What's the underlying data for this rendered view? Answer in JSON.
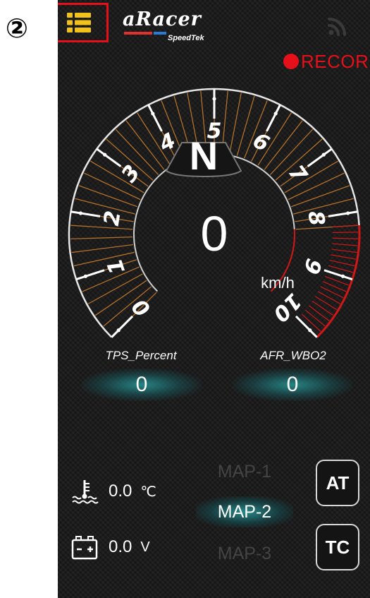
{
  "annotation": {
    "step_label": "②"
  },
  "header": {
    "logo_text": "aRacer",
    "logo_subtext": "SpeedTek",
    "menu_icon": "list-menu-icon",
    "signal_icon": "rss-signal-icon",
    "record_label": "RECOR"
  },
  "gauge": {
    "gear": "N",
    "speed": "0",
    "speed_unit": "km/h",
    "rpm_ticks": [
      "0",
      "1",
      "2",
      "3",
      "4",
      "5",
      "6",
      "7",
      "8",
      "9",
      "10"
    ],
    "redline_from": 8.2
  },
  "sensors": [
    {
      "label": "TPS_Percent",
      "value": "0"
    },
    {
      "label": "AFR_WBO2",
      "value": "0"
    }
  ],
  "stats": {
    "temperature": {
      "value": "0.0",
      "unit": "℃",
      "icon": "coolant-temperature-icon"
    },
    "voltage": {
      "value": "0.0",
      "unit": "V",
      "icon": "battery-icon"
    }
  },
  "maps": [
    {
      "label": "MAP-1",
      "active": false
    },
    {
      "label": "MAP-2",
      "active": true
    },
    {
      "label": "MAP-3",
      "active": false
    }
  ],
  "buttons": {
    "at": "AT",
    "tc": "TC"
  },
  "colors": {
    "accent_red": "#e5101a",
    "menu_yellow": "#f2c21b",
    "tick_orange": "#c47a2c",
    "redline": "#d01818",
    "glow_teal": "#2a9696",
    "logo_red": "#e03030",
    "logo_blue": "#2a7bd8"
  }
}
